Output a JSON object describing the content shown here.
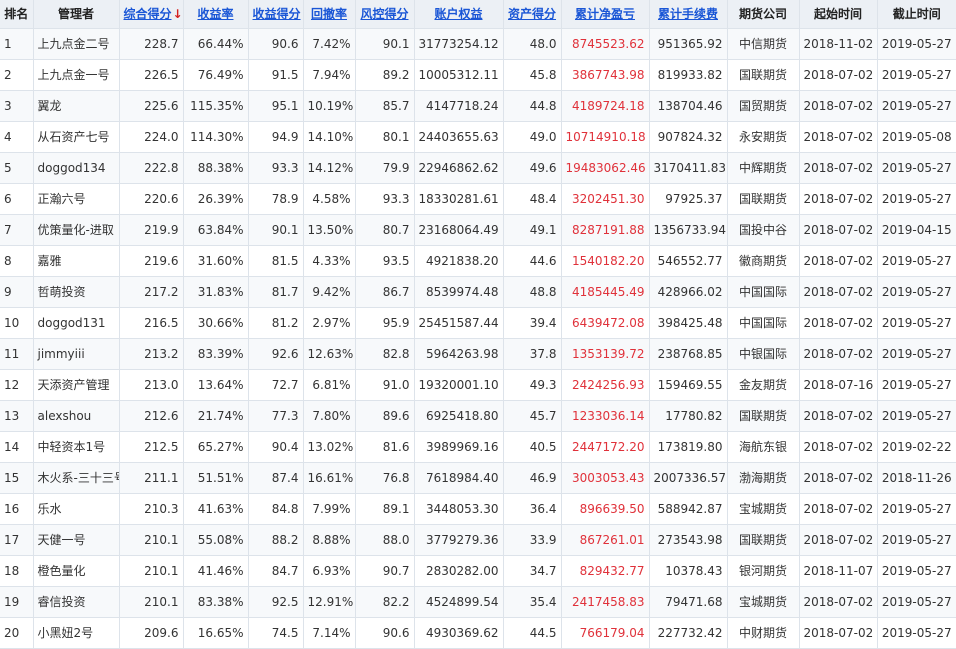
{
  "colors": {
    "accent": "#1a56d6",
    "profit": "#e0313a",
    "header_bg": "#ecf0f5"
  },
  "header": {
    "rank": "排名",
    "manager": "管理者",
    "score": "综合得分",
    "return": "收益率",
    "return_score": "收益得分",
    "drawdown": "回撤率",
    "risk_score": "风控得分",
    "equity": "账户权益",
    "asset_score": "资产得分",
    "net_profit": "累计净盈亏",
    "fees": "累计手续费",
    "broker": "期货公司",
    "start": "起始时间",
    "end": "截止时间",
    "sort_icon": "sort-down-arrow-icon"
  },
  "rows": [
    {
      "rank": "1",
      "manager": "上九点金二号",
      "score": "228.7",
      "ret": "66.44%",
      "ret_score": "90.6",
      "drawdown": "7.42%",
      "risk_score": "90.1",
      "equity": "31773254.12",
      "asset_score": "48.0",
      "net_profit": "8745523.62",
      "fees": "951365.92",
      "broker": "中信期货",
      "start": "2018-11-02",
      "end": "2019-05-27"
    },
    {
      "rank": "2",
      "manager": "上九点金一号",
      "score": "226.5",
      "ret": "76.49%",
      "ret_score": "91.5",
      "drawdown": "7.94%",
      "risk_score": "89.2",
      "equity": "10005312.11",
      "asset_score": "45.8",
      "net_profit": "3867743.98",
      "fees": "819933.82",
      "broker": "国联期货",
      "start": "2018-07-02",
      "end": "2019-05-27"
    },
    {
      "rank": "3",
      "manager": "翼龙",
      "score": "225.6",
      "ret": "115.35%",
      "ret_score": "95.1",
      "drawdown": "10.19%",
      "risk_score": "85.7",
      "equity": "4147718.24",
      "asset_score": "44.8",
      "net_profit": "4189724.18",
      "fees": "138704.46",
      "broker": "国贸期货",
      "start": "2018-07-02",
      "end": "2019-05-27"
    },
    {
      "rank": "4",
      "manager": "从石资产七号",
      "score": "224.0",
      "ret": "114.30%",
      "ret_score": "94.9",
      "drawdown": "14.10%",
      "risk_score": "80.1",
      "equity": "24403655.63",
      "asset_score": "49.0",
      "net_profit": "10714910.18",
      "fees": "907824.32",
      "broker": "永安期货",
      "start": "2018-07-02",
      "end": "2019-05-08"
    },
    {
      "rank": "5",
      "manager": "doggod134",
      "score": "222.8",
      "ret": "88.38%",
      "ret_score": "93.3",
      "drawdown": "14.12%",
      "risk_score": "79.9",
      "equity": "22946862.62",
      "asset_score": "49.6",
      "net_profit": "19483062.46",
      "fees": "3170411.83",
      "broker": "中辉期货",
      "start": "2018-07-02",
      "end": "2019-05-27"
    },
    {
      "rank": "6",
      "manager": "正瀚六号",
      "score": "220.6",
      "ret": "26.39%",
      "ret_score": "78.9",
      "drawdown": "4.58%",
      "risk_score": "93.3",
      "equity": "18330281.61",
      "asset_score": "48.4",
      "net_profit": "3202451.30",
      "fees": "97925.37",
      "broker": "国联期货",
      "start": "2018-07-02",
      "end": "2019-05-27"
    },
    {
      "rank": "7",
      "manager": "优策量化-进取",
      "score": "219.9",
      "ret": "63.84%",
      "ret_score": "90.1",
      "drawdown": "13.50%",
      "risk_score": "80.7",
      "equity": "23168064.49",
      "asset_score": "49.1",
      "net_profit": "8287191.88",
      "fees": "1356733.94",
      "broker": "国投中谷",
      "start": "2018-07-02",
      "end": "2019-04-15"
    },
    {
      "rank": "8",
      "manager": "嘉雅",
      "score": "219.6",
      "ret": "31.60%",
      "ret_score": "81.5",
      "drawdown": "4.33%",
      "risk_score": "93.5",
      "equity": "4921838.20",
      "asset_score": "44.6",
      "net_profit": "1540182.20",
      "fees": "546552.77",
      "broker": "徽商期货",
      "start": "2018-07-02",
      "end": "2019-05-27"
    },
    {
      "rank": "9",
      "manager": "哲萌投资",
      "score": "217.2",
      "ret": "31.83%",
      "ret_score": "81.7",
      "drawdown": "9.42%",
      "risk_score": "86.7",
      "equity": "8539974.48",
      "asset_score": "48.8",
      "net_profit": "4185445.49",
      "fees": "428966.02",
      "broker": "中国国际",
      "start": "2018-07-02",
      "end": "2019-05-27"
    },
    {
      "rank": "10",
      "manager": "doggod131",
      "score": "216.5",
      "ret": "30.66%",
      "ret_score": "81.2",
      "drawdown": "2.97%",
      "risk_score": "95.9",
      "equity": "25451587.44",
      "asset_score": "39.4",
      "net_profit": "6439472.08",
      "fees": "398425.48",
      "broker": "中国国际",
      "start": "2018-07-02",
      "end": "2019-05-27"
    },
    {
      "rank": "11",
      "manager": "jimmyiii",
      "score": "213.2",
      "ret": "83.39%",
      "ret_score": "92.6",
      "drawdown": "12.63%",
      "risk_score": "82.8",
      "equity": "5964263.98",
      "asset_score": "37.8",
      "net_profit": "1353139.72",
      "fees": "238768.85",
      "broker": "中银国际",
      "start": "2018-07-02",
      "end": "2019-05-27"
    },
    {
      "rank": "12",
      "manager": "天添资产管理",
      "score": "213.0",
      "ret": "13.64%",
      "ret_score": "72.7",
      "drawdown": "6.81%",
      "risk_score": "91.0",
      "equity": "19320001.10",
      "asset_score": "49.3",
      "net_profit": "2424256.93",
      "fees": "159469.55",
      "broker": "金友期货",
      "start": "2018-07-16",
      "end": "2019-05-27"
    },
    {
      "rank": "13",
      "manager": "alexshou",
      "score": "212.6",
      "ret": "21.74%",
      "ret_score": "77.3",
      "drawdown": "7.80%",
      "risk_score": "89.6",
      "equity": "6925418.80",
      "asset_score": "45.7",
      "net_profit": "1233036.14",
      "fees": "17780.82",
      "broker": "国联期货",
      "start": "2018-07-02",
      "end": "2019-05-27"
    },
    {
      "rank": "14",
      "manager": "中轻资本1号",
      "score": "212.5",
      "ret": "65.27%",
      "ret_score": "90.4",
      "drawdown": "13.02%",
      "risk_score": "81.6",
      "equity": "3989969.16",
      "asset_score": "40.5",
      "net_profit": "2447172.20",
      "fees": "173819.80",
      "broker": "海航东银",
      "start": "2018-07-02",
      "end": "2019-02-22"
    },
    {
      "rank": "15",
      "manager": "木火系-三十三号",
      "score": "211.1",
      "ret": "51.51%",
      "ret_score": "87.4",
      "drawdown": "16.61%",
      "risk_score": "76.8",
      "equity": "7618984.40",
      "asset_score": "46.9",
      "net_profit": "3003053.43",
      "fees": "2007336.57",
      "broker": "渤海期货",
      "start": "2018-07-02",
      "end": "2018-11-26"
    },
    {
      "rank": "16",
      "manager": "乐水",
      "score": "210.3",
      "ret": "41.63%",
      "ret_score": "84.8",
      "drawdown": "7.99%",
      "risk_score": "89.1",
      "equity": "3448053.30",
      "asset_score": "36.4",
      "net_profit": "896639.50",
      "fees": "588942.87",
      "broker": "宝城期货",
      "start": "2018-07-02",
      "end": "2019-05-27"
    },
    {
      "rank": "17",
      "manager": "天健一号",
      "score": "210.1",
      "ret": "55.08%",
      "ret_score": "88.2",
      "drawdown": "8.88%",
      "risk_score": "88.0",
      "equity": "3779279.36",
      "asset_score": "33.9",
      "net_profit": "867261.01",
      "fees": "273543.98",
      "broker": "国联期货",
      "start": "2018-07-02",
      "end": "2019-05-27"
    },
    {
      "rank": "18",
      "manager": "橙色量化",
      "score": "210.1",
      "ret": "41.46%",
      "ret_score": "84.7",
      "drawdown": "6.93%",
      "risk_score": "90.7",
      "equity": "2830282.00",
      "asset_score": "34.7",
      "net_profit": "829432.77",
      "fees": "10378.43",
      "broker": "银河期货",
      "start": "2018-11-07",
      "end": "2019-05-27"
    },
    {
      "rank": "19",
      "manager": "睿信投资",
      "score": "210.1",
      "ret": "83.38%",
      "ret_score": "92.5",
      "drawdown": "12.91%",
      "risk_score": "82.2",
      "equity": "4524899.54",
      "asset_score": "35.4",
      "net_profit": "2417458.83",
      "fees": "79471.68",
      "broker": "宝城期货",
      "start": "2018-07-02",
      "end": "2019-05-27"
    },
    {
      "rank": "20",
      "manager": "小黑妞2号",
      "score": "209.6",
      "ret": "16.65%",
      "ret_score": "74.5",
      "drawdown": "7.14%",
      "risk_score": "90.6",
      "equity": "4930369.62",
      "asset_score": "44.5",
      "net_profit": "766179.04",
      "fees": "227732.42",
      "broker": "中财期货",
      "start": "2018-07-02",
      "end": "2019-05-27"
    }
  ]
}
